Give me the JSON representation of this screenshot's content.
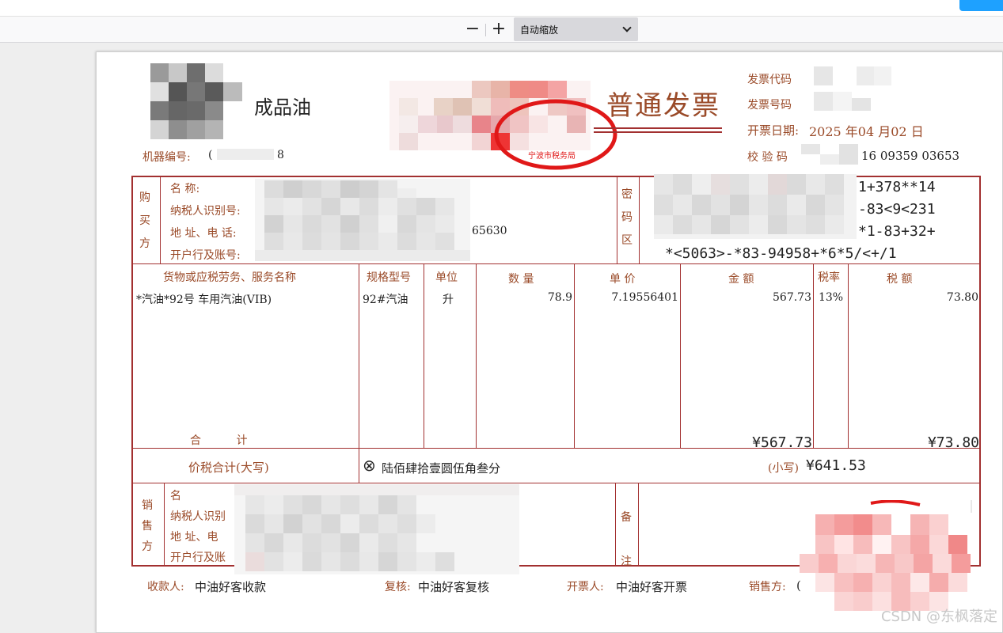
{
  "viewer": {
    "zoom_out": "−",
    "zoom_in": "+",
    "zoom_label": "自动缩放"
  },
  "invoice": {
    "product_type": "成品油",
    "title": "普通发票",
    "stamp_text": "宁波市税务局",
    "machine_no_label": "机器编号:",
    "machine_no_value_start": "(",
    "machine_no_value_end": "8",
    "code_label": "发票代码",
    "number_label": "发票号码",
    "date_label": "开票日期:",
    "date_value": "2025 年04 月02 日",
    "check_label": "校 验 码",
    "check_value": "16 09359 03653",
    "buyer": {
      "section_label": "购买方",
      "name_label": "名          称:",
      "tax_id_label": "纳税人识别号:",
      "address_label": "地 址、电 话:",
      "address_value_end": "65630",
      "bank_label": "开户行及账号:"
    },
    "cipher": {
      "section_label": "密码区",
      "lines": [
        "1+378**14",
        "-83<9<231",
        "*1-83+32+",
        "*<5063>-*83-94958+*6*5/<+/1"
      ]
    },
    "columns": [
      "货物或应税劳务、服务名称",
      "规格型号",
      "单位",
      "数  量",
      "单  价",
      "金    额",
      "税率",
      "税    额"
    ],
    "items": [
      {
        "name": "*汽油*92号 车用汽油(VIB)",
        "spec": "92#汽油",
        "unit": "升",
        "qty": "78.9",
        "price": "7.19556401",
        "amount": "567.73",
        "rate": "13%",
        "tax": "73.80"
      }
    ],
    "total_label": "合          计",
    "total_amount": "¥567.73",
    "total_tax": "¥73.80",
    "grand_label": "价税合计(大写)",
    "grand_symbol": "⊗",
    "grand_words": "陆佰肆拾壹圆伍角叁分",
    "grand_small_label": "(小写)",
    "grand_small_value": "¥641.53",
    "seller": {
      "section_label": "销售方",
      "name_label": "名",
      "tax_id_label": "纳税人识别",
      "address_label": "地 址、电",
      "bank_label": "开户行及账"
    },
    "remarks_label": "备注",
    "payee_label": "收款人:",
    "payee_value": "中油好客收款",
    "reviewer_label": "复核:",
    "reviewer_value": "中油好客复核",
    "issuer_label": "开票人:",
    "issuer_value": "中油好客开票",
    "seller_sign_label": "销售方:",
    "seller_sign_value": "("
  },
  "watermark": "CSDN @东枫落定",
  "colors": {
    "frame": "#a23030",
    "label": "#9a4a28",
    "text": "#222222",
    "stamp": "#e01818"
  }
}
